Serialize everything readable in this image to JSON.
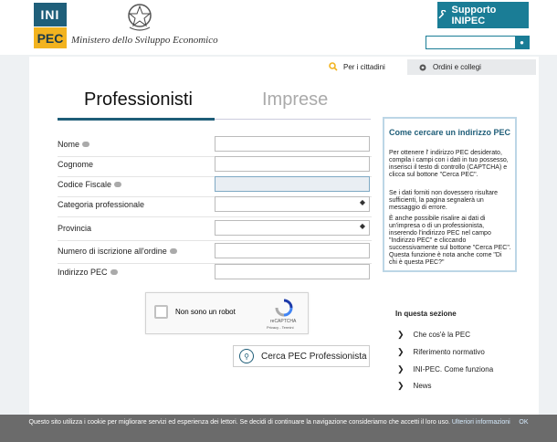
{
  "header": {
    "logo_ini": "INI",
    "logo_pec": "PEC",
    "ministry": "Ministero dello Sviluppo Economico",
    "support_label": "Supporto INIPEC",
    "search_placeholder": ""
  },
  "nav": {
    "cittadini": "Per i cittadini",
    "ordini": "Ordini e collegi"
  },
  "tabs": {
    "professionisti": "Professionisti",
    "imprese": "Imprese"
  },
  "form": {
    "nome": "Nome",
    "cognome": "Cognome",
    "codice_fiscale": "Codice Fiscale",
    "categoria": "Categoria professionale",
    "provincia": "Provincia",
    "numero_iscrizione": "Numero di iscrizione all'ordine",
    "indirizzo_pec": "Indirizzo PEC"
  },
  "captcha": {
    "text": "Non sono un robot",
    "brand": "reCAPTCHA",
    "terms": "Privacy - Termini"
  },
  "search_button": "Cerca PEC Professionista",
  "info": {
    "title": "Come cercare un indirizzo PEC",
    "p1": "Per ottenere l' indirizzo PEC desiderato, compila i campi con i dati in tuo possesso, inserisci il testo di controllo (CAPTCHA) e clicca sul bottone \"Cerca PEC\".",
    "p2": "Se i dati forniti non dovessero risultare sufficienti, la pagina segnalerà un messaggio di errore.",
    "p3": "È anche possibile risalire ai dati di un'impresa o di un professionista, inserendo l'indirizzo PEC nel campo \"Indirizzo PEC\" e cliccando successivamente  sul bottone \"Cerca PEC\". Questa funzione è nota anche come \"Di chi è questa PEC?\""
  },
  "sezione": {
    "title": "In questa sezione",
    "links": [
      "Che cos'è la PEC",
      "Riferimento normativo",
      "INI-PEC. Come funziona",
      "News"
    ]
  },
  "cookie": {
    "text": "Questo sito utilizza i cookie per migliorare servizi ed esperienza dei lettori. Se decidi di continuare la navigazione consideriamo che accetti il loro uso.",
    "more": "Ulteriori informazioni",
    "ok": "OK"
  },
  "colors": {
    "teal": "#1a7d96",
    "navy": "#1e5d78",
    "yellow": "#f2b31f"
  }
}
